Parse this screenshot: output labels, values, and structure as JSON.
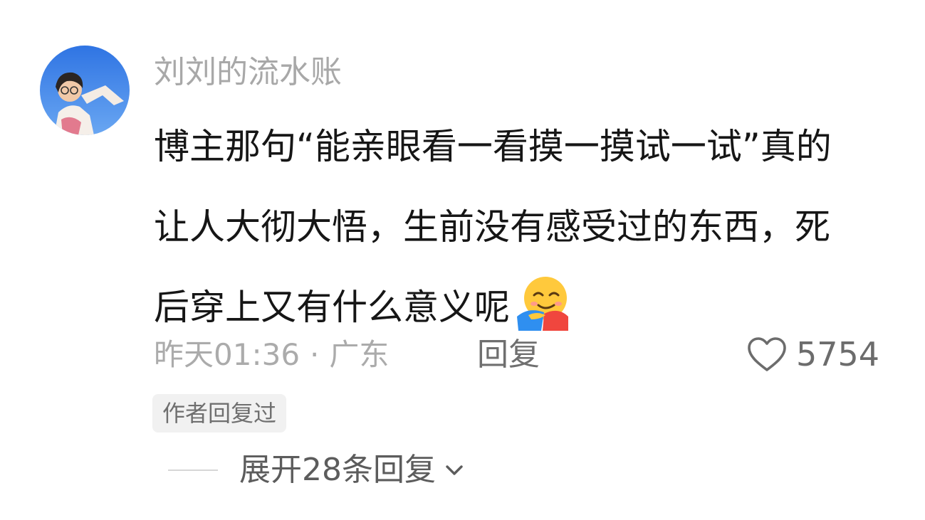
{
  "comment": {
    "username": "刘刘的流水账",
    "content_lines": [
      "博主那句“能亲眼看一看摸一摸试一试”真的",
      "让人大彻大悟，生前没有感受过的东西，死",
      "后穿上又有什么意义呢"
    ],
    "emoji": "hugging-face-emoji",
    "time": "昨天01:36",
    "separator": "·",
    "location": "广东",
    "reply_label": "回复",
    "like_count": "5754",
    "author_replied_badge": "作者回复过",
    "expand_replies_label": "展开28条回复"
  },
  "icons": {
    "like": "heart-outline-icon",
    "expand": "chevron-down-icon"
  },
  "colors": {
    "username": "#a8a8a8",
    "content": "#161616",
    "meta": "#ababab",
    "badge_bg": "#f1f1f1"
  }
}
